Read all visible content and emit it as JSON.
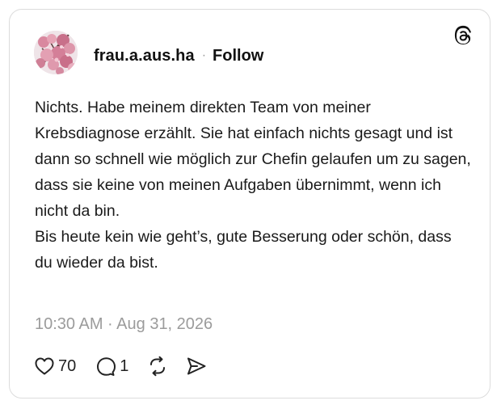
{
  "post": {
    "username": "frau.a.aus.ha",
    "separator": "·",
    "follow_label": "Follow",
    "paragraphs": [
      "Nichts. Habe meinem direkten Team von meiner Krebsdiagnose erzählt. Sie hat einfach nichts gesagt und ist dann so schnell wie möglich zur Chefin gelaufen um zu sagen, dass sie keine von meinen Aufgaben übernimmt, wenn ich nicht da bin.",
      "Bis heute kein wie geht’s, gute Besserung oder schön, dass du wieder da bist."
    ],
    "timestamp": "10:30 AM · Aug 31, 2026"
  },
  "actions": {
    "like_count": "70",
    "reply_count": "1"
  },
  "icons": {
    "logo": "threads-logo-icon",
    "like": "heart-icon",
    "reply": "comment-bubble-icon",
    "repost": "repost-icon",
    "share": "send-icon"
  },
  "colors": {
    "text": "#111111",
    "muted": "#9b9b9b",
    "border": "#dcdcdc",
    "avatar_blossom": "#d9889f"
  }
}
